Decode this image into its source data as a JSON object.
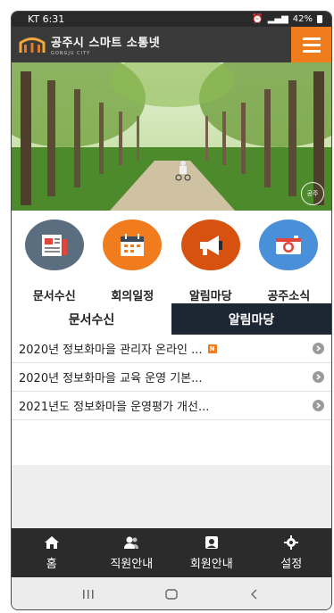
{
  "status_bar": {
    "carrier_time": "KT 6:31",
    "battery": "42%"
  },
  "header": {
    "title": "공주시 스마트 소통넷",
    "subtitle": "GONGJU CITY",
    "logo_icon": "gongju-logo-icon",
    "menu_icon": "hamburger-icon",
    "accent_color": "#f07c1d"
  },
  "hero": {
    "stamp_text": "공주"
  },
  "quick_menu": [
    {
      "label": "문서수신",
      "icon": "document-icon",
      "color": "#5a6e80"
    },
    {
      "label": "회의일정",
      "icon": "calendar-icon",
      "color": "#f07c1d"
    },
    {
      "label": "알림마당",
      "icon": "megaphone-icon",
      "color": "#d7520f"
    },
    {
      "label": "공주소식",
      "icon": "camera-icon",
      "color": "#4a90d9"
    }
  ],
  "tabs": {
    "docs": "문서수신",
    "notice": "알림마당"
  },
  "notices": [
    {
      "title": "2020년 정보화마을 관리자 온라인 ...",
      "badge": "N"
    },
    {
      "title": "2020년 정보화마을 교육 운영 기본..."
    },
    {
      "title": "2021년도 정보화마을 운영평가 개선..."
    }
  ],
  "bottom_nav": [
    {
      "label": "홈",
      "icon": "home-icon"
    },
    {
      "label": "직원안내",
      "icon": "staff-icon"
    },
    {
      "label": "회원안내",
      "icon": "member-icon"
    },
    {
      "label": "설정",
      "icon": "settings-icon"
    }
  ],
  "system_nav": {
    "recents": "recent-apps-icon",
    "home": "system-home-icon",
    "back": "back-icon"
  }
}
